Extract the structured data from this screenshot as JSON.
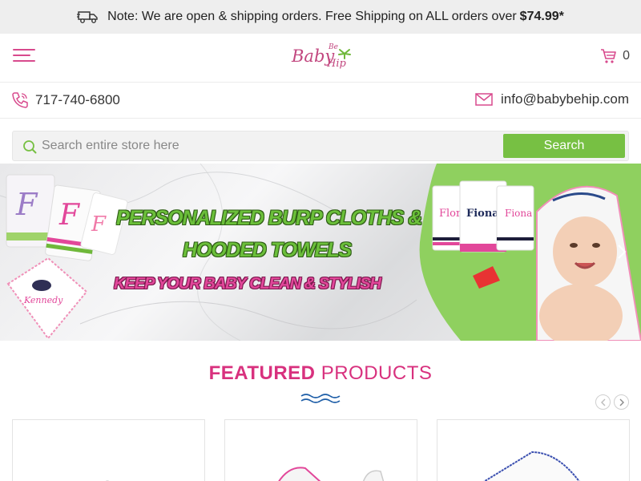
{
  "notice": {
    "text": "Note: We are open & shipping orders. Free Shipping on ALL orders over",
    "amount": "$74.99*",
    "icon": "truck-icon"
  },
  "header": {
    "logo_baby": "Baby",
    "logo_be": "Be",
    "logo_hip": "Hip",
    "cart_count": "0",
    "icons": [
      "menu-icon",
      "cart-icon"
    ]
  },
  "contact": {
    "phone": "717-740-6800",
    "email": "info@babybehip.com"
  },
  "search": {
    "placeholder": "Search entire store here",
    "button_label": "Search"
  },
  "banner": {
    "line1": "PERSONALIZED BURP CLOTHS &",
    "line2": "HOODED TOWELS",
    "line3": "KEEP YOUR BABY CLEAN & STYLISH",
    "towel_names": [
      "Flora",
      "Fiona",
      "Fiona"
    ],
    "monogram_letter": "F",
    "towel_name_left": "Kennedy"
  },
  "featured": {
    "bold": "FEATURED",
    "light": "PRODUCTS"
  },
  "colors": {
    "accent_pink": "#d8317e",
    "accent_green": "#77c043",
    "notice_bg": "#eeeeee"
  }
}
